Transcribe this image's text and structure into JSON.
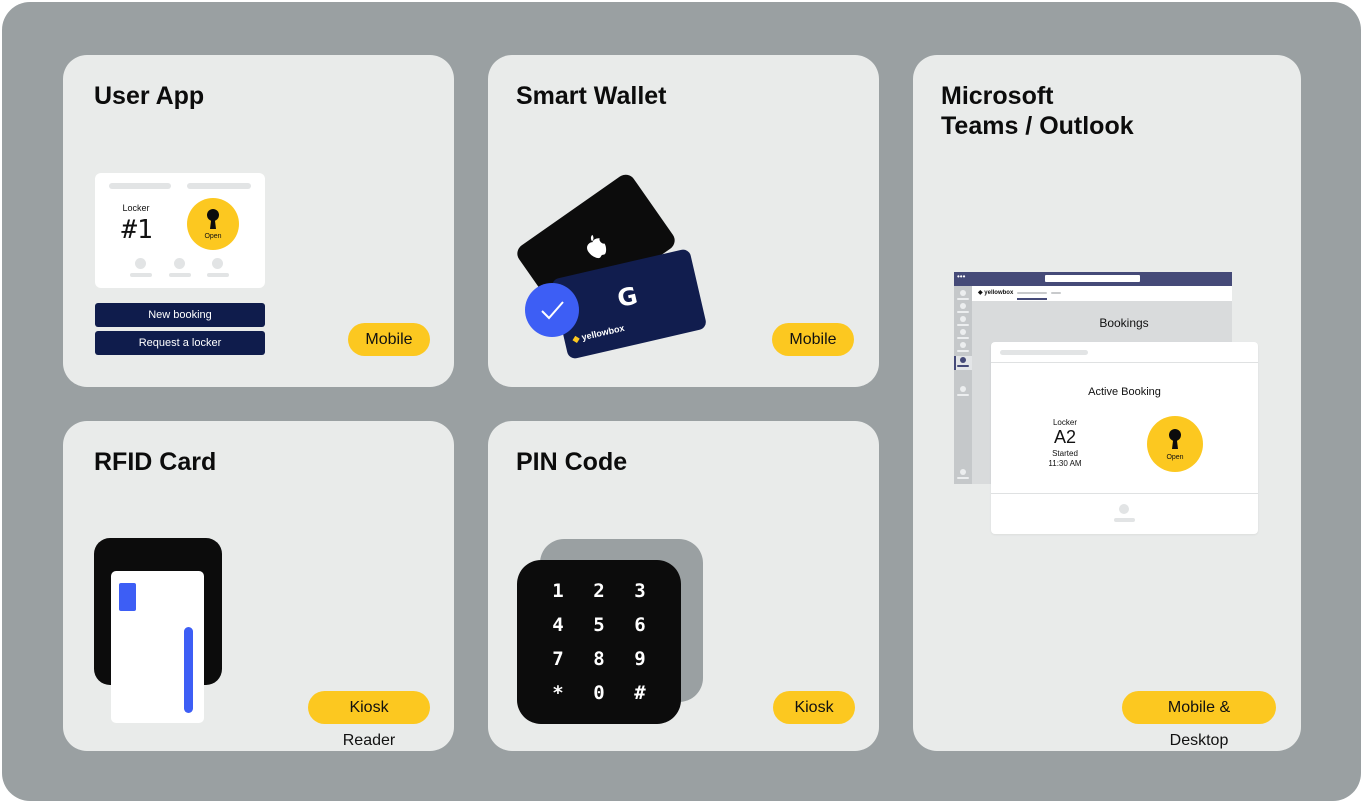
{
  "cards": {
    "user_app": {
      "title": "User App",
      "badge": "Mobile",
      "phone": {
        "locker_label": "Locker",
        "locker_number": "#1",
        "open_label": "Open",
        "new_booking": "New booking",
        "request_locker": "Request a locker"
      }
    },
    "smart_wallet": {
      "title": "Smart Wallet",
      "badge": "Mobile",
      "google_letter": "G",
      "brand": "yellowbox"
    },
    "teams": {
      "title_line1": "Microsoft",
      "title_line2": "Teams / Outlook",
      "badge": "Mobile & Desktop",
      "window": {
        "brand": "yellowbox",
        "bookings_heading": "Bookings",
        "active_booking": "Active Booking",
        "locker_label": "Locker",
        "locker_id": "A2",
        "started_label": "Started",
        "started_time": "11:30 AM",
        "open_label": "Open"
      }
    },
    "rfid": {
      "title": "RFID Card",
      "badge": "Kiosk Reader"
    },
    "pin": {
      "title": "PIN Code",
      "badge": "Kiosk",
      "keys": [
        "1",
        "2",
        "3",
        "4",
        "5",
        "6",
        "7",
        "8",
        "9",
        "*",
        "0",
        "#"
      ]
    }
  },
  "colors": {
    "background": "#9aa0a2",
    "card": "#e9ebea",
    "accent_yellow": "#fcc820",
    "navy": "#0f1c4c",
    "blue": "#3d5ef5",
    "black": "#0c0c0c"
  }
}
